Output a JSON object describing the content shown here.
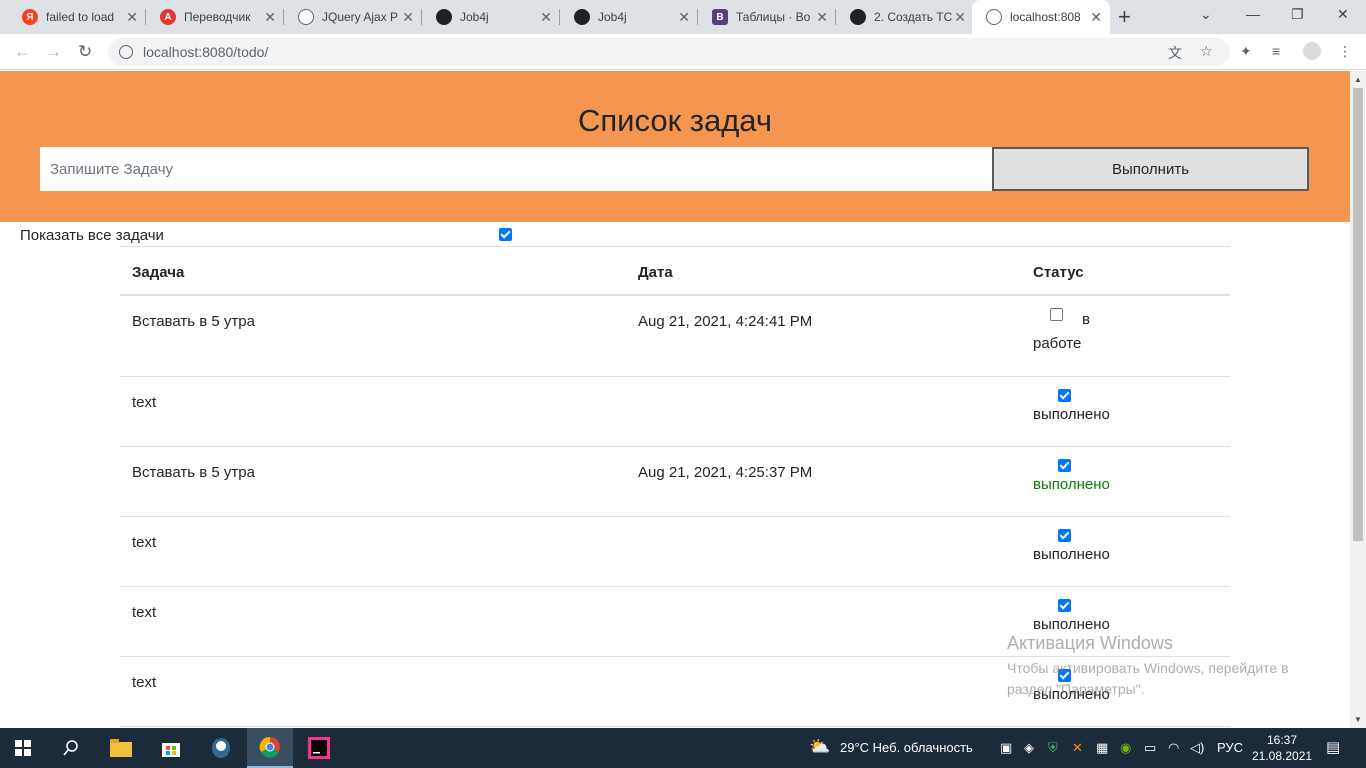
{
  "browser": {
    "tabs": [
      {
        "title": "failed to load",
        "favicon_color": "#fc3f1d",
        "favicon_glyph": "Я"
      },
      {
        "title": "Переводчик",
        "favicon_color": "#e53935",
        "favicon_glyph": "A"
      },
      {
        "title": "JQuery Ajax P",
        "favicon_color": "#5f6368",
        "favicon_glyph": ""
      },
      {
        "title": "Job4j",
        "favicon_color": "#202124",
        "favicon_glyph": ""
      },
      {
        "title": "Job4j",
        "favicon_color": "#202124",
        "favicon_glyph": ""
      },
      {
        "title": "Таблицы · Bo",
        "favicon_color": "#563d7c",
        "favicon_glyph": "B"
      },
      {
        "title": "2. Создать TC",
        "favicon_color": "#202124",
        "favicon_glyph": ""
      },
      {
        "title": "localhost:808",
        "favicon_color": "#5f6368",
        "favicon_glyph": ""
      }
    ],
    "new_tab_icon": "plus-icon",
    "url": "localhost:8080/todo/"
  },
  "page": {
    "title": "Список задач",
    "task_input_placeholder": "Запишите Задачу",
    "submit_label": "Выполнить",
    "show_all_label": "Показать все задачи",
    "show_all_checked": true,
    "accent_color": "#f4964f"
  },
  "table": {
    "headers": {
      "task": "Задача",
      "date": "Дата",
      "status": "Статус"
    },
    "rows": [
      {
        "task": "Вставать в 5 утра",
        "date": "Aug 21, 2021, 4:24:41 PM",
        "done": false,
        "status": "в работе"
      },
      {
        "task": "text",
        "date": "",
        "done": true,
        "status": "выполнено"
      },
      {
        "task": "Вставать в 5 утра",
        "date": "Aug 21, 2021, 4:25:37 PM",
        "done": true,
        "status": "выполнено"
      },
      {
        "task": "text",
        "date": "",
        "done": true,
        "status": "выполнено"
      },
      {
        "task": "text",
        "date": "",
        "done": true,
        "status": "выполнено"
      },
      {
        "task": "text",
        "date": "",
        "done": true,
        "status": "выполнено"
      }
    ]
  },
  "watermark": {
    "title": "Активация Windows",
    "text": "Чтобы активировать Windows, перейдите в раздел \"Параметры\"."
  },
  "taskbar": {
    "weather": "29°C  Неб. облачность",
    "language": "РУС",
    "time": "16:37",
    "date": "21.08.2021"
  }
}
